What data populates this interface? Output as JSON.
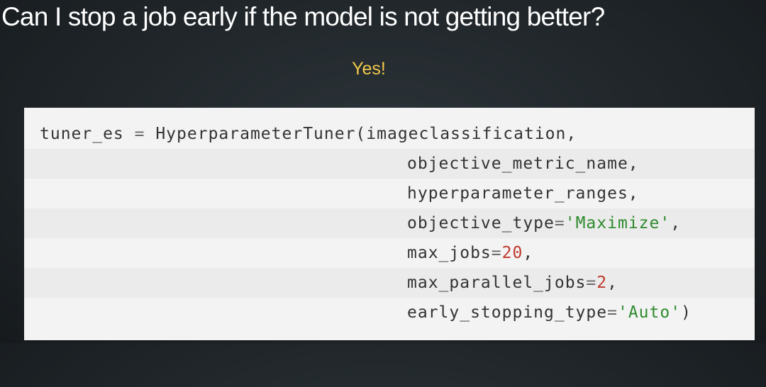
{
  "slide": {
    "title": "Can I stop a job early if the model is not getting better?",
    "subtitle": "Yes!"
  },
  "code": {
    "line0": {
      "var": "tuner_es",
      "eq": " = ",
      "call": "HyperparameterTuner(imageclassification,"
    },
    "line1": {
      "text": "objective_metric_name,"
    },
    "line2": {
      "text": "hyperparameter_ranges,"
    },
    "line3": {
      "key": "objective_type",
      "eq": "=",
      "value": "'Maximize'",
      "tail": ","
    },
    "line4": {
      "key": "max_jobs",
      "eq": "=",
      "value": "20",
      "tail": ","
    },
    "line5": {
      "key": "max_parallel_jobs",
      "eq": "=",
      "value": "2",
      "tail": ","
    },
    "line6": {
      "key": "early_stopping_type",
      "eq": "=",
      "value": "'Auto'",
      "tail": ")"
    }
  },
  "colors": {
    "title": "#ffffff",
    "subtitle": "#f2c94c",
    "code_background": "#f3f3f3",
    "string": "#2e8a2e",
    "number": "#c0392b"
  }
}
